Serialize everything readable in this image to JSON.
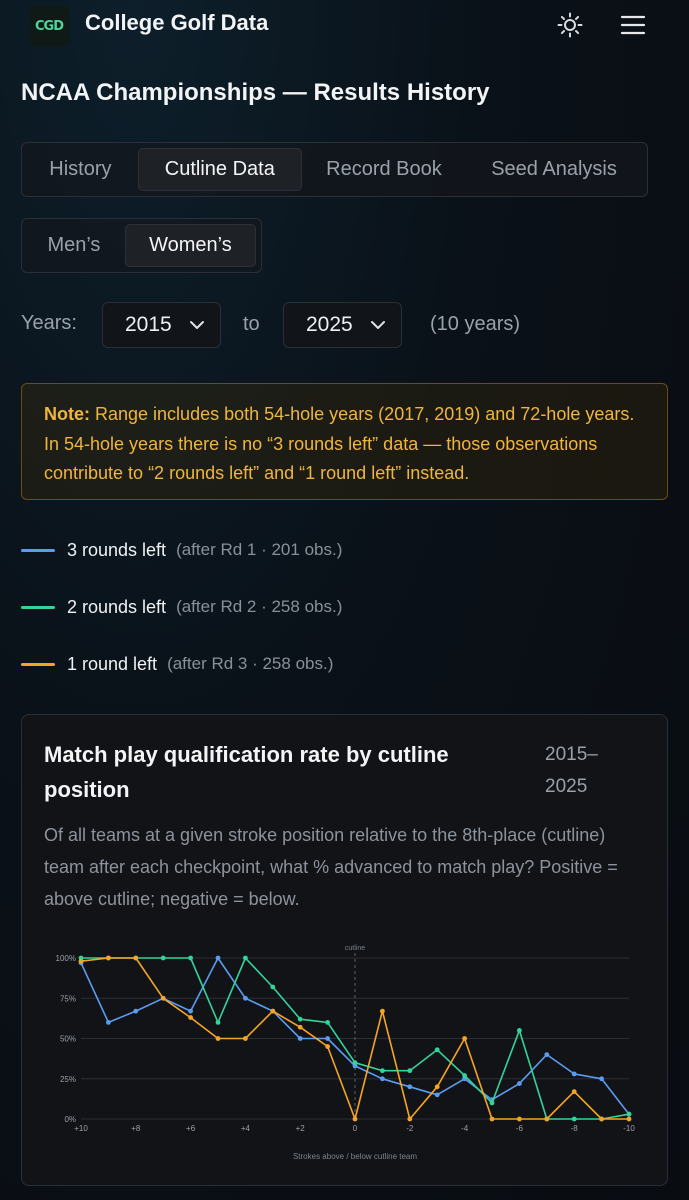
{
  "app": {
    "logo_text": "CGD",
    "title": "College Golf Data"
  },
  "page_title": "NCAA Championships — Results History",
  "tabs": [
    {
      "label": "History",
      "active": false
    },
    {
      "label": "Cutline Data",
      "active": true
    },
    {
      "label": "Record Book",
      "active": false
    },
    {
      "label": "Seed Analysis",
      "active": false
    }
  ],
  "gender": [
    {
      "label": "Men’s",
      "active": false
    },
    {
      "label": "Women’s",
      "active": true
    }
  ],
  "years": {
    "label": "Years:",
    "from": "2015",
    "to_label": "to",
    "to": "2025",
    "count": "(10 years)"
  },
  "note": {
    "label": "Note:",
    "text": " Range includes both 54-hole years (2017, 2019) and 72-hole years. In 54-hole years there is no “3 rounds left” data — those observations contribute to “2 rounds left” and “1 round left” instead."
  },
  "legend": [
    {
      "name": "3 rounds left",
      "sub": "(after Rd 1 · 201 obs.)",
      "color": "#5b9cf0"
    },
    {
      "name": "2 rounds left",
      "sub": "(after Rd 2 · 258 obs.)",
      "color": "#34d399"
    },
    {
      "name": "1 round left",
      "sub": "(after Rd 3 · 258 obs.)",
      "color": "#f5a524"
    }
  ],
  "card": {
    "title": "Match play qualification rate by cutline position",
    "range": "2015–2025",
    "description": "Of all teams at a given stroke position relative to the 8th-place (cutline) team after each checkpoint, what % advanced to match play? Positive = above cutline; negative = below."
  },
  "chart_data": {
    "type": "line",
    "x": [
      10,
      9,
      8,
      7,
      6,
      5,
      4,
      3,
      2,
      1,
      0,
      -1,
      -2,
      -3,
      -4,
      -5,
      -6,
      -7,
      -8,
      -9,
      -10
    ],
    "x_ticks": [
      "+10",
      "+8",
      "+6",
      "+4",
      "+2",
      "0",
      "-2",
      "-4",
      "-6",
      "-8",
      "-10"
    ],
    "y_ticks": [
      "0%",
      "25%",
      "50%",
      "75%",
      "100%"
    ],
    "ylim": [
      0,
      100
    ],
    "xlabel": "Strokes above / below cutline team",
    "ylabel": "",
    "vline": {
      "x": 0,
      "label": "cutline"
    },
    "grid": true,
    "series": [
      {
        "name": "3 rounds left",
        "color": "#5b9cf0",
        "values": [
          97,
          60,
          67,
          75,
          67,
          100,
          75,
          67,
          50,
          50,
          33,
          25,
          20,
          15,
          25,
          12,
          22,
          40,
          28,
          25,
          3
        ]
      },
      {
        "name": "2 rounds left",
        "color": "#34d399",
        "values": [
          100,
          100,
          100,
          100,
          100,
          60,
          100,
          82,
          62,
          60,
          35,
          30,
          30,
          43,
          27,
          10,
          55,
          0,
          0,
          0,
          3
        ]
      },
      {
        "name": "1 round left",
        "color": "#f5a524",
        "values": [
          98,
          100,
          100,
          75,
          63,
          50,
          50,
          67,
          57,
          45,
          0,
          67,
          0,
          20,
          50,
          0,
          0,
          0,
          17,
          0,
          0
        ]
      }
    ]
  }
}
